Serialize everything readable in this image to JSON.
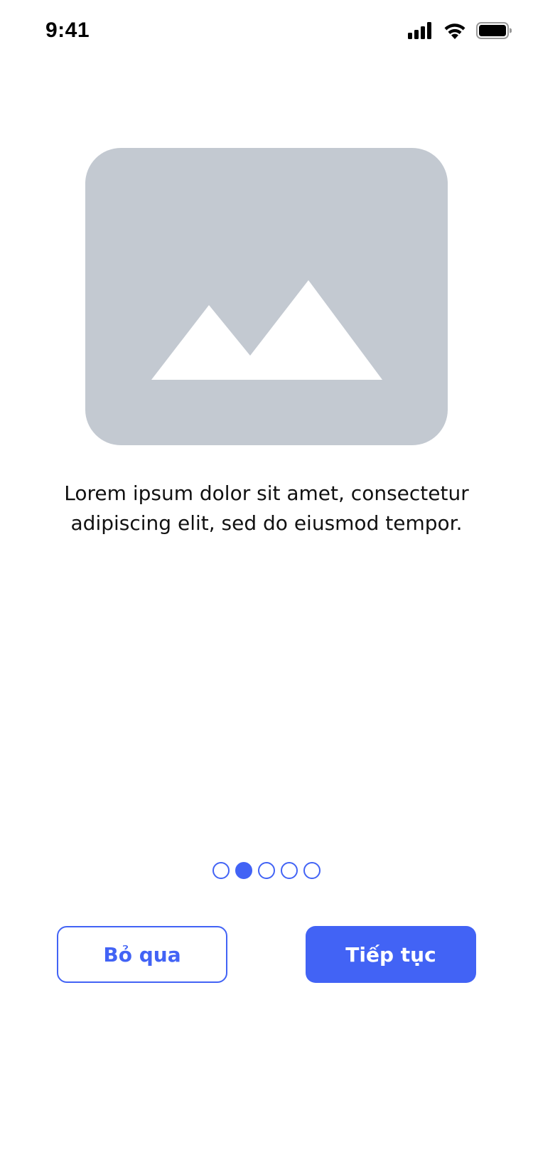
{
  "status_bar": {
    "time": "9:41",
    "icons": [
      "cellular-signal-icon",
      "wifi-icon",
      "battery-icon"
    ]
  },
  "illustration": {
    "icon": "image-placeholder-icon",
    "background_color": "#c3c9d1",
    "shape_color": "#ffffff"
  },
  "onboarding": {
    "description": "Lorem ipsum dolor sit amet, consectetur adipiscing elit, sed do eiusmod tempor."
  },
  "pagination": {
    "total": 5,
    "current_index": 1,
    "color": "#4263f5"
  },
  "actions": {
    "skip_label": "Bỏ qua",
    "next_label": "Tiếp tục",
    "accent_color": "#4263f5"
  }
}
